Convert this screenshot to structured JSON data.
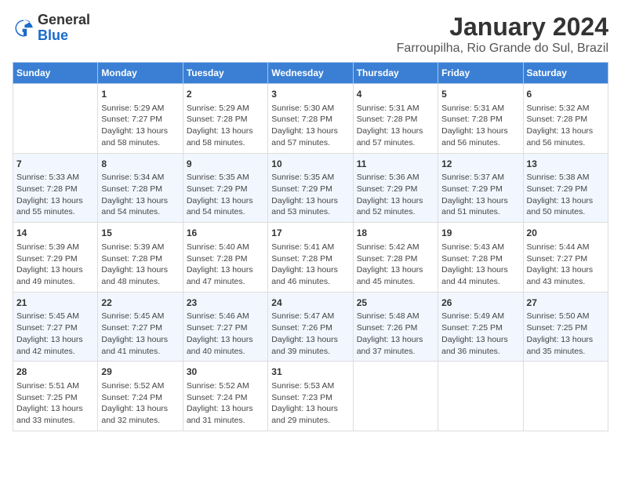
{
  "header": {
    "logo": {
      "general": "General",
      "blue": "Blue"
    },
    "title": "January 2024",
    "subtitle": "Farroupilha, Rio Grande do Sul, Brazil"
  },
  "weekdays": [
    "Sunday",
    "Monday",
    "Tuesday",
    "Wednesday",
    "Thursday",
    "Friday",
    "Saturday"
  ],
  "weeks": [
    [
      {
        "day": "",
        "info": ""
      },
      {
        "day": "1",
        "info": "Sunrise: 5:29 AM\nSunset: 7:27 PM\nDaylight: 13 hours\nand 58 minutes."
      },
      {
        "day": "2",
        "info": "Sunrise: 5:29 AM\nSunset: 7:28 PM\nDaylight: 13 hours\nand 58 minutes."
      },
      {
        "day": "3",
        "info": "Sunrise: 5:30 AM\nSunset: 7:28 PM\nDaylight: 13 hours\nand 57 minutes."
      },
      {
        "day": "4",
        "info": "Sunrise: 5:31 AM\nSunset: 7:28 PM\nDaylight: 13 hours\nand 57 minutes."
      },
      {
        "day": "5",
        "info": "Sunrise: 5:31 AM\nSunset: 7:28 PM\nDaylight: 13 hours\nand 56 minutes."
      },
      {
        "day": "6",
        "info": "Sunrise: 5:32 AM\nSunset: 7:28 PM\nDaylight: 13 hours\nand 56 minutes."
      }
    ],
    [
      {
        "day": "7",
        "info": "Sunrise: 5:33 AM\nSunset: 7:28 PM\nDaylight: 13 hours\nand 55 minutes."
      },
      {
        "day": "8",
        "info": "Sunrise: 5:34 AM\nSunset: 7:28 PM\nDaylight: 13 hours\nand 54 minutes."
      },
      {
        "day": "9",
        "info": "Sunrise: 5:35 AM\nSunset: 7:29 PM\nDaylight: 13 hours\nand 54 minutes."
      },
      {
        "day": "10",
        "info": "Sunrise: 5:35 AM\nSunset: 7:29 PM\nDaylight: 13 hours\nand 53 minutes."
      },
      {
        "day": "11",
        "info": "Sunrise: 5:36 AM\nSunset: 7:29 PM\nDaylight: 13 hours\nand 52 minutes."
      },
      {
        "day": "12",
        "info": "Sunrise: 5:37 AM\nSunset: 7:29 PM\nDaylight: 13 hours\nand 51 minutes."
      },
      {
        "day": "13",
        "info": "Sunrise: 5:38 AM\nSunset: 7:29 PM\nDaylight: 13 hours\nand 50 minutes."
      }
    ],
    [
      {
        "day": "14",
        "info": "Sunrise: 5:39 AM\nSunset: 7:29 PM\nDaylight: 13 hours\nand 49 minutes."
      },
      {
        "day": "15",
        "info": "Sunrise: 5:39 AM\nSunset: 7:28 PM\nDaylight: 13 hours\nand 48 minutes."
      },
      {
        "day": "16",
        "info": "Sunrise: 5:40 AM\nSunset: 7:28 PM\nDaylight: 13 hours\nand 47 minutes."
      },
      {
        "day": "17",
        "info": "Sunrise: 5:41 AM\nSunset: 7:28 PM\nDaylight: 13 hours\nand 46 minutes."
      },
      {
        "day": "18",
        "info": "Sunrise: 5:42 AM\nSunset: 7:28 PM\nDaylight: 13 hours\nand 45 minutes."
      },
      {
        "day": "19",
        "info": "Sunrise: 5:43 AM\nSunset: 7:28 PM\nDaylight: 13 hours\nand 44 minutes."
      },
      {
        "day": "20",
        "info": "Sunrise: 5:44 AM\nSunset: 7:27 PM\nDaylight: 13 hours\nand 43 minutes."
      }
    ],
    [
      {
        "day": "21",
        "info": "Sunrise: 5:45 AM\nSunset: 7:27 PM\nDaylight: 13 hours\nand 42 minutes."
      },
      {
        "day": "22",
        "info": "Sunrise: 5:45 AM\nSunset: 7:27 PM\nDaylight: 13 hours\nand 41 minutes."
      },
      {
        "day": "23",
        "info": "Sunrise: 5:46 AM\nSunset: 7:27 PM\nDaylight: 13 hours\nand 40 minutes."
      },
      {
        "day": "24",
        "info": "Sunrise: 5:47 AM\nSunset: 7:26 PM\nDaylight: 13 hours\nand 39 minutes."
      },
      {
        "day": "25",
        "info": "Sunrise: 5:48 AM\nSunset: 7:26 PM\nDaylight: 13 hours\nand 37 minutes."
      },
      {
        "day": "26",
        "info": "Sunrise: 5:49 AM\nSunset: 7:25 PM\nDaylight: 13 hours\nand 36 minutes."
      },
      {
        "day": "27",
        "info": "Sunrise: 5:50 AM\nSunset: 7:25 PM\nDaylight: 13 hours\nand 35 minutes."
      }
    ],
    [
      {
        "day": "28",
        "info": "Sunrise: 5:51 AM\nSunset: 7:25 PM\nDaylight: 13 hours\nand 33 minutes."
      },
      {
        "day": "29",
        "info": "Sunrise: 5:52 AM\nSunset: 7:24 PM\nDaylight: 13 hours\nand 32 minutes."
      },
      {
        "day": "30",
        "info": "Sunrise: 5:52 AM\nSunset: 7:24 PM\nDaylight: 13 hours\nand 31 minutes."
      },
      {
        "day": "31",
        "info": "Sunrise: 5:53 AM\nSunset: 7:23 PM\nDaylight: 13 hours\nand 29 minutes."
      },
      {
        "day": "",
        "info": ""
      },
      {
        "day": "",
        "info": ""
      },
      {
        "day": "",
        "info": ""
      }
    ]
  ]
}
